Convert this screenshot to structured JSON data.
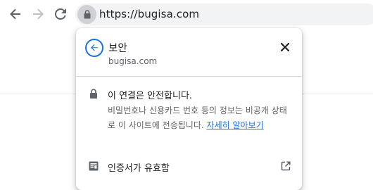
{
  "toolbar": {
    "url": "https://bugisa.com"
  },
  "popup": {
    "title": "보안",
    "subtitle": "bugisa.com",
    "security_title": "이 연결은 안전합니다.",
    "security_desc": "비밀번호나 신용카드 번호 등의 정보는 비공개 상태로 이 사이트에 전송됩니다.",
    "learn_more": "자세히 알아보기",
    "certificate_label": "인증서가 유효함"
  },
  "colors": {
    "accent": "#1a73e8",
    "text": "#202124",
    "secondary_text": "#5f6368"
  },
  "icons": [
    "back-arrow-icon",
    "forward-arrow-icon",
    "reload-icon",
    "lock-icon",
    "circle-back-arrow-icon",
    "close-icon",
    "certificate-icon",
    "external-link-icon"
  ]
}
